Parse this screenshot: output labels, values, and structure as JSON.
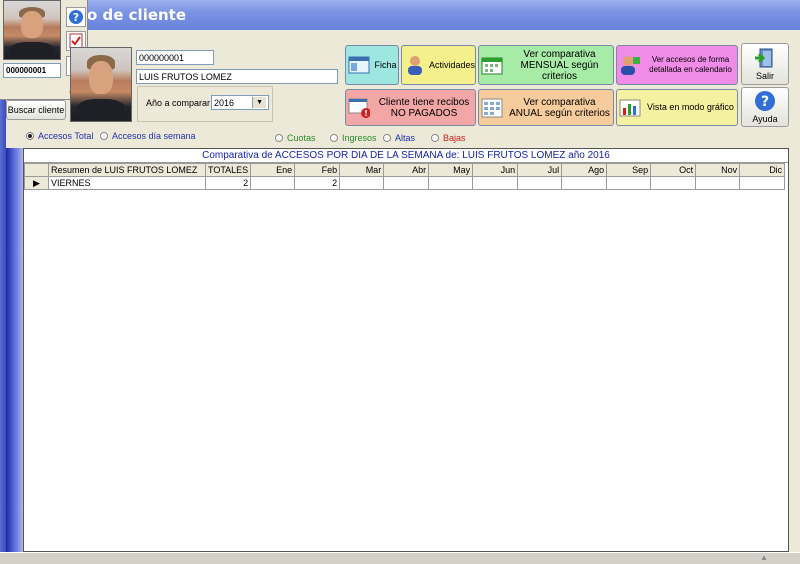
{
  "window": {
    "title": "o de cliente"
  },
  "popup": {
    "client_code": "000000001"
  },
  "client": {
    "code": "000000001",
    "name": "LUIS FRUTOS LOMEZ",
    "search_button": "Buscar cliente",
    "year_label": "Año a comparar",
    "year_value": "2016"
  },
  "actions": {
    "ficha": "Ficha",
    "actividades": "Actividades",
    "mensual": "Ver comparativa MENSUAL según criterios",
    "calendario": "Ver accesos de forma detallada en calendario",
    "salir": "Salir",
    "recibos": "Cliente tiene recibos NO PAGADOS",
    "anual": "Ver comparativa ANUAL según criterios",
    "grafico": "Vista en modo gráfico",
    "ayuda": "Ayuda"
  },
  "colors": {
    "teal": "#9EE6E0",
    "yellow": "#F4F08C",
    "green": "#A6EBA6",
    "pink": "#F08CE8",
    "red": "#F2A6A6",
    "peach": "#F6CC9C",
    "lightyellow": "#F4F2A0"
  },
  "options": {
    "mode": [
      {
        "label": "Accesos Total",
        "selected": true
      },
      {
        "label": "Accesos día semana",
        "selected": false
      }
    ],
    "types": [
      {
        "label": "Cuotas",
        "color": "#2A8A2A"
      },
      {
        "label": "Ingresos",
        "color": "#2A8A2A"
      },
      {
        "label": "Altas",
        "color": "#1F2FB0"
      },
      {
        "label": "Bajas",
        "color": "#D02020"
      }
    ]
  },
  "grid": {
    "title": "Comparativa de ACCESOS POR DIA DE LA SEMANA de: LUIS FRUTOS LOMEZ año 2016",
    "headers": [
      "Resumen de LUIS FRUTOS LOMEZ",
      "TOTALES",
      "Ene",
      "Feb",
      "Mar",
      "Abr",
      "May",
      "Jun",
      "Jul",
      "Ago",
      "Sep",
      "Oct",
      "Nov",
      "Dic"
    ],
    "rows": [
      [
        "VIERNES",
        "2",
        "",
        "2",
        "",
        "",
        "",
        "",
        "",
        "",
        "",
        "",
        "",
        ""
      ]
    ]
  }
}
